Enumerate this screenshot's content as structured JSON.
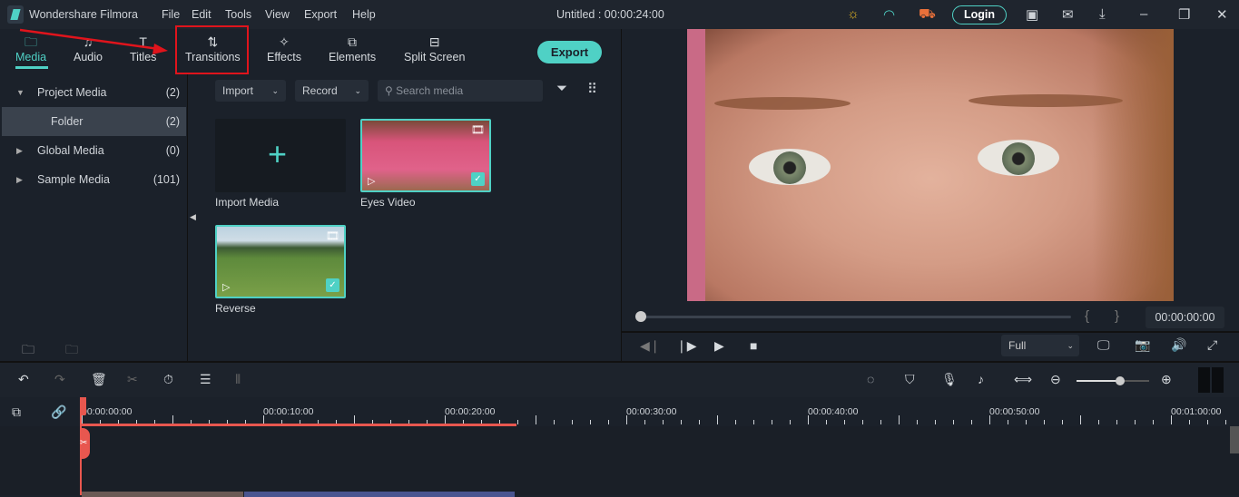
{
  "app": {
    "name": "Wondershare Filmora",
    "title": "Untitled : 00:00:24:00",
    "login": "Login"
  },
  "menu": [
    "File",
    "Edit",
    "Tools",
    "View",
    "Export",
    "Help"
  ],
  "tabs": [
    {
      "label": "Media",
      "icon": "folder-icon"
    },
    {
      "label": "Audio",
      "icon": "music-note-icon"
    },
    {
      "label": "Titles",
      "icon": "text-icon"
    },
    {
      "label": "Transitions",
      "icon": "transition-icon"
    },
    {
      "label": "Effects",
      "icon": "effects-icon"
    },
    {
      "label": "Elements",
      "icon": "elements-icon"
    },
    {
      "label": "Split Screen",
      "icon": "split-screen-icon"
    }
  ],
  "export_label": "Export",
  "sidebar": [
    {
      "label": "Project Media",
      "count": "(2)"
    },
    {
      "label": "Folder",
      "count": "(2)"
    },
    {
      "label": "Global Media",
      "count": "(0)"
    },
    {
      "label": "Sample Media",
      "count": "(101)"
    }
  ],
  "media_bar": {
    "import": "Import",
    "record": "Record",
    "search_placeholder": "Search media"
  },
  "media": [
    {
      "label": "Import Media"
    },
    {
      "label": "Eyes Video"
    },
    {
      "label": "Reverse"
    }
  ],
  "player": {
    "timecode": "00:00:00:00",
    "quality": "Full",
    "progress": 0
  },
  "timeline": {
    "ruler_labels": [
      "00:00:00:00",
      "00:00:10:00",
      "00:00:20:00",
      "00:00:30:00",
      "00:00:40:00",
      "00:00:50:00",
      "00:01:00:00"
    ],
    "zoom_level": 0.6
  },
  "colors": {
    "accent": "#4fd1c5",
    "playhead": "#e8574f",
    "highlight": "#e0141c"
  }
}
